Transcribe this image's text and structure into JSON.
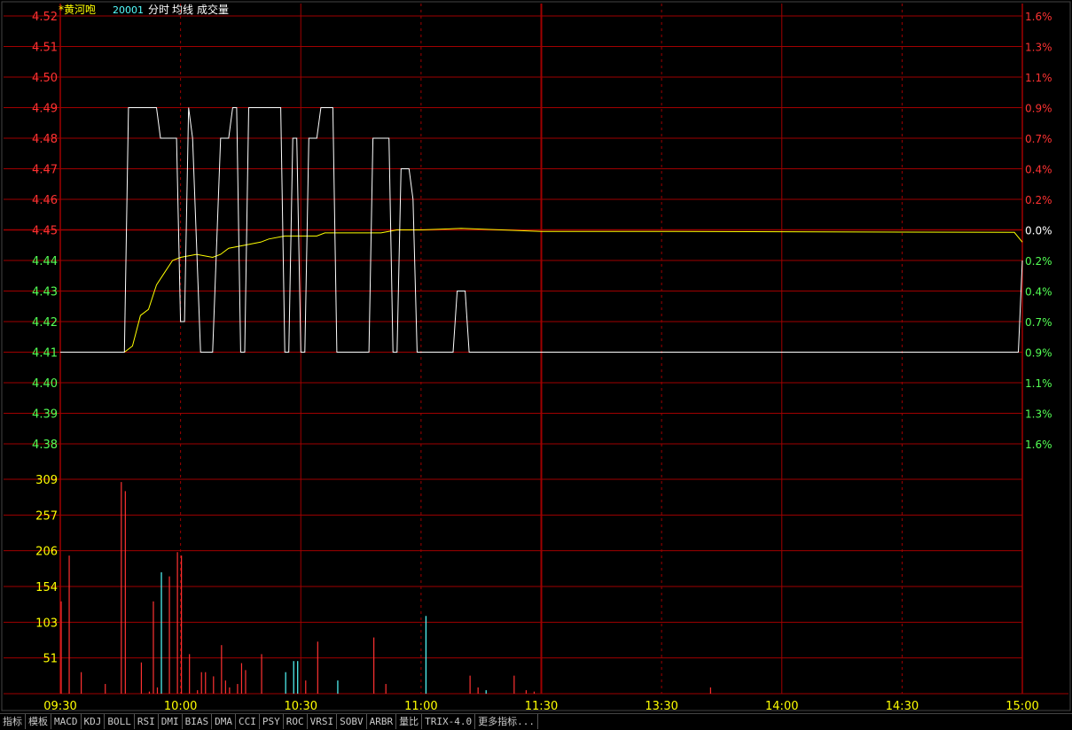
{
  "header": {
    "name": "*黄河咆",
    "code": "20001",
    "labels": [
      "分时",
      "均线",
      "成交量"
    ]
  },
  "toolbar": {
    "items": [
      "指标",
      "模板",
      "MACD",
      "KDJ",
      "BOLL",
      "RSI",
      "DMI",
      "BIAS",
      "DMA",
      "CCI",
      "PSY",
      "ROC",
      "VRSI",
      "SOBV",
      "ARBR",
      "量比",
      "TRIX-4.0",
      "更多指标..."
    ]
  },
  "colors": {
    "up": "#ff3232",
    "down": "#54ff54",
    "grid": "#a00000",
    "price_line": "#ffffff",
    "avg_line": "#ffff00",
    "vol_label": "#ffff00",
    "cyan": "#54ffff",
    "time_label": "#ffff00"
  },
  "chart_data": {
    "type": "line",
    "prev_close": 4.45,
    "price_axis": {
      "ticks": [
        "4.52",
        "4.51",
        "4.50",
        "4.49",
        "4.48",
        "4.47",
        "4.46",
        "4.45",
        "4.44",
        "4.43",
        "4.42",
        "4.41",
        "4.40",
        "4.39",
        "4.38"
      ],
      "ylim": [
        4.38,
        4.52
      ]
    },
    "pct_axis": {
      "ticks": [
        "1.6%",
        "1.3%",
        "1.1%",
        "0.9%",
        "0.7%",
        "0.4%",
        "0.2%",
        "0.0%",
        "0.2%",
        "0.4%",
        "0.7%",
        "0.9%",
        "1.1%",
        "1.3%",
        "1.6%"
      ]
    },
    "volume_axis": {
      "ticks": [
        "309",
        "257",
        "206",
        "154",
        "103",
        "51"
      ],
      "ylim": [
        0,
        309
      ]
    },
    "time_axis": {
      "ticks": [
        "09:30",
        "10:00",
        "10:30",
        "11:00",
        "11:30",
        "13:30",
        "14:00",
        "14:30",
        "15:00"
      ]
    },
    "price_series": {
      "name": "",
      "points": [
        [
          0,
          4.41
        ],
        [
          16,
          4.41
        ],
        [
          17,
          4.49
        ],
        [
          24,
          4.49
        ],
        [
          25,
          4.48
        ],
        [
          29,
          4.48
        ],
        [
          30,
          4.42
        ],
        [
          31,
          4.42
        ],
        [
          32,
          4.49
        ],
        [
          33,
          4.48
        ],
        [
          35,
          4.41
        ],
        [
          38,
          4.41
        ],
        [
          40,
          4.48
        ],
        [
          42,
          4.48
        ],
        [
          43,
          4.49
        ],
        [
          44,
          4.49
        ],
        [
          45,
          4.41
        ],
        [
          46,
          4.41
        ],
        [
          47,
          4.49
        ],
        [
          55,
          4.49
        ],
        [
          56,
          4.41
        ],
        [
          57,
          4.41
        ],
        [
          58,
          4.48
        ],
        [
          59,
          4.48
        ],
        [
          60,
          4.41
        ],
        [
          61,
          4.41
        ],
        [
          62,
          4.48
        ],
        [
          64,
          4.48
        ],
        [
          65,
          4.49
        ],
        [
          68,
          4.49
        ],
        [
          69,
          4.41
        ],
        [
          77,
          4.41
        ],
        [
          78,
          4.48
        ],
        [
          82,
          4.48
        ],
        [
          83,
          4.41
        ],
        [
          84,
          4.41
        ],
        [
          85,
          4.47
        ],
        [
          87,
          4.47
        ],
        [
          88,
          4.46
        ],
        [
          89,
          4.41
        ],
        [
          98,
          4.41
        ],
        [
          99,
          4.43
        ],
        [
          101,
          4.43
        ],
        [
          102,
          4.41
        ],
        [
          239,
          4.41
        ],
        [
          240,
          4.44
        ]
      ]
    },
    "avg_series": {
      "name": "",
      "points": [
        [
          0,
          4.41
        ],
        [
          16,
          4.41
        ],
        [
          18,
          4.412
        ],
        [
          20,
          4.422
        ],
        [
          22,
          4.424
        ],
        [
          24,
          4.432
        ],
        [
          26,
          4.436
        ],
        [
          28,
          4.44
        ],
        [
          30,
          4.441
        ],
        [
          34,
          4.442
        ],
        [
          38,
          4.441
        ],
        [
          40,
          4.442
        ],
        [
          42,
          4.444
        ],
        [
          46,
          4.445
        ],
        [
          50,
          4.446
        ],
        [
          52,
          4.447
        ],
        [
          56,
          4.448
        ],
        [
          60,
          4.448
        ],
        [
          64,
          4.448
        ],
        [
          66,
          4.449
        ],
        [
          70,
          4.449
        ],
        [
          80,
          4.449
        ],
        [
          84,
          4.45
        ],
        [
          90,
          4.45
        ],
        [
          100,
          4.4505
        ],
        [
          110,
          4.45
        ],
        [
          120,
          4.4495
        ],
        [
          150,
          4.4495
        ],
        [
          200,
          4.4493
        ],
        [
          238,
          4.4492
        ],
        [
          240,
          4.446
        ]
      ]
    },
    "volume_series": {
      "name": "",
      "bars": [
        [
          0,
          133,
          "up"
        ],
        [
          2,
          199,
          "up"
        ],
        [
          5,
          31,
          "up"
        ],
        [
          11,
          14,
          "up"
        ],
        [
          15,
          305,
          "up"
        ],
        [
          16,
          292,
          "up"
        ],
        [
          20,
          45,
          "up"
        ],
        [
          22,
          3,
          "up"
        ],
        [
          23,
          133,
          "up"
        ],
        [
          24,
          9,
          "up"
        ],
        [
          25,
          175,
          "cyan"
        ],
        [
          27,
          169,
          "up"
        ],
        [
          29,
          204,
          "up"
        ],
        [
          30,
          199,
          "up"
        ],
        [
          32,
          57,
          "up"
        ],
        [
          34,
          5,
          "up"
        ],
        [
          35,
          31,
          "up"
        ],
        [
          36,
          31,
          "up"
        ],
        [
          38,
          25,
          "up"
        ],
        [
          40,
          70,
          "up"
        ],
        [
          41,
          19,
          "up"
        ],
        [
          42,
          9,
          "up"
        ],
        [
          44,
          14,
          "up"
        ],
        [
          45,
          44,
          "up"
        ],
        [
          46,
          34,
          "up"
        ],
        [
          50,
          57,
          "up"
        ],
        [
          56,
          31,
          "cyan"
        ],
        [
          58,
          47,
          "cyan"
        ],
        [
          59,
          47,
          "cyan"
        ],
        [
          61,
          19,
          "up"
        ],
        [
          64,
          75,
          "up"
        ],
        [
          69,
          19,
          "cyan"
        ],
        [
          78,
          81,
          "up"
        ],
        [
          81,
          14,
          "up"
        ],
        [
          91,
          112,
          "cyan"
        ],
        [
          102,
          26,
          "up"
        ],
        [
          104,
          9,
          "up"
        ],
        [
          106,
          5,
          "cyan"
        ],
        [
          113,
          26,
          "up"
        ],
        [
          116,
          5,
          "up"
        ],
        [
          118,
          3,
          "up"
        ],
        [
          162,
          9,
          "up"
        ]
      ]
    }
  }
}
